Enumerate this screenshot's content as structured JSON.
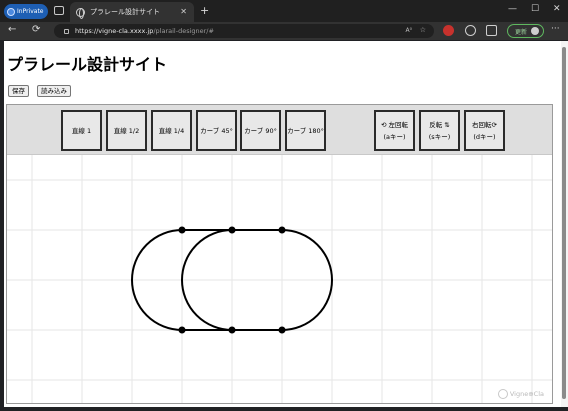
{
  "browser": {
    "inprivate_label": "InPrivate",
    "tab_title": "プラレール設計サイト",
    "tab_close": "✕",
    "new_tab": "+",
    "minimize": "—",
    "maximize": "☐",
    "close": "✕",
    "back": "←",
    "refresh": "⟳",
    "url_host": "https://vigne-cla.xxxx.jp",
    "url_path": "/plarail-designer/#",
    "reader_label": "A⁰",
    "favorite": "☆",
    "update_label": "更新",
    "more": "···"
  },
  "page": {
    "title": "プラレール設計サイト",
    "save_label": "保存",
    "load_label": "読み込み"
  },
  "palette": {
    "straight_1": "直線 1",
    "straight_half": "直線 1/2",
    "straight_quarter": "直線 1/4",
    "curve_45": "カーブ 45°",
    "curve_90": "カーブ 90°",
    "curve_180": "カーブ 180°",
    "rotate_left": "⟲ 左回転",
    "rotate_left_key": "(aキー)",
    "flip": "反転 ⇅",
    "flip_key": "(sキー)",
    "rotate_right": "右回転⟳",
    "rotate_right_key": "(dキー)"
  },
  "watermark": "Vigne⊕Cla",
  "colors": {
    "track": "#000000",
    "grid": "#e6e6e6",
    "palette_bg": "#dedede",
    "update_green": "#5fb85f",
    "inprivate_blue": "#1e5fb4"
  }
}
